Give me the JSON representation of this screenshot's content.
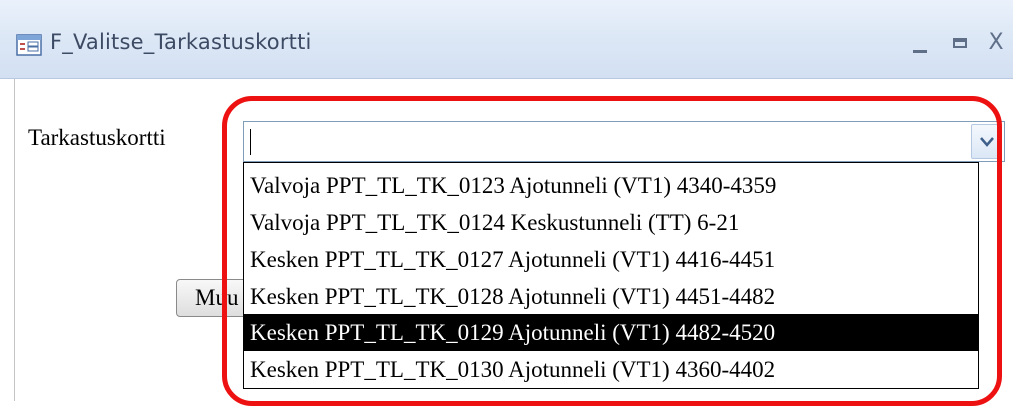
{
  "window": {
    "title": "F_Valitse_Tarkastuskortti",
    "icon": "form-icon",
    "controls": {
      "minimize": "minimize-icon",
      "maximize": "maximize-icon",
      "close": "X"
    }
  },
  "form": {
    "label": "Tarkastuskortti",
    "combo_value": "",
    "hidden_button_label": "Muu"
  },
  "dropdown": {
    "items": [
      "Valvoja PPT_TL_TK_0123 Ajotunneli (VT1) 4340-4359",
      "Valvoja PPT_TL_TK_0124 Keskustunneli (TT) 6-21",
      "Kesken PPT_TL_TK_0127 Ajotunneli (VT1) 4416-4451",
      "Kesken PPT_TL_TK_0128 Ajotunneli (VT1) 4451-4482",
      "Kesken PPT_TL_TK_0129 Ajotunneli (VT1) 4482-4520",
      "Kesken PPT_TL_TK_0130 Ajotunneli (VT1) 4360-4402"
    ],
    "selected_item": "Kesken PPT_TL_TK_0129 Ajotunneli (VT1) 4482-4520"
  },
  "annotation": {
    "highlight_color": "#ee1111"
  }
}
